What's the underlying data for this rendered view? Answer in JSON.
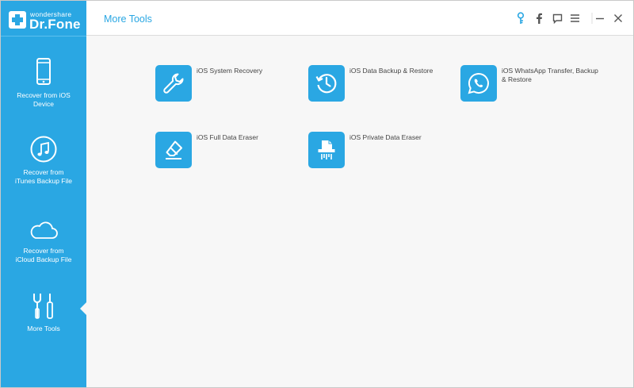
{
  "brand": {
    "small": "wondershare",
    "name": "Dr.Fone"
  },
  "header": {
    "title": "More Tools",
    "icons": [
      "key-icon",
      "facebook-icon",
      "feedback-icon",
      "menu-icon",
      "minimize-icon",
      "close-icon"
    ]
  },
  "sidebar": {
    "items": [
      {
        "label": "Recover from iOS\nDevice",
        "icon": "phone-icon",
        "active": false
      },
      {
        "label": "Recover from\niTunes Backup File",
        "icon": "music-icon",
        "active": false
      },
      {
        "label": "Recover from\niCloud Backup File",
        "icon": "cloud-icon",
        "active": false
      },
      {
        "label": "More Tools",
        "icon": "tools-icon",
        "active": true
      }
    ]
  },
  "tools": [
    {
      "label": "iOS System Recovery",
      "icon": "wrench-icon"
    },
    {
      "label": "iOS Data Backup & Restore",
      "icon": "restore-clock-icon"
    },
    {
      "label": "iOS WhatsApp Transfer, Backup & Restore",
      "icon": "whatsapp-icon"
    },
    {
      "label": "iOS Full Data Eraser",
      "icon": "eraser-icon"
    },
    {
      "label": "iOS Private Data Eraser",
      "icon": "shredder-icon"
    }
  ],
  "colors": {
    "accent": "#2aa7e3",
    "sidebar_bg": "#2aa7e3",
    "content_bg": "#f7f7f7",
    "title_text": "#2aa7e3",
    "label_text": "#444444"
  }
}
